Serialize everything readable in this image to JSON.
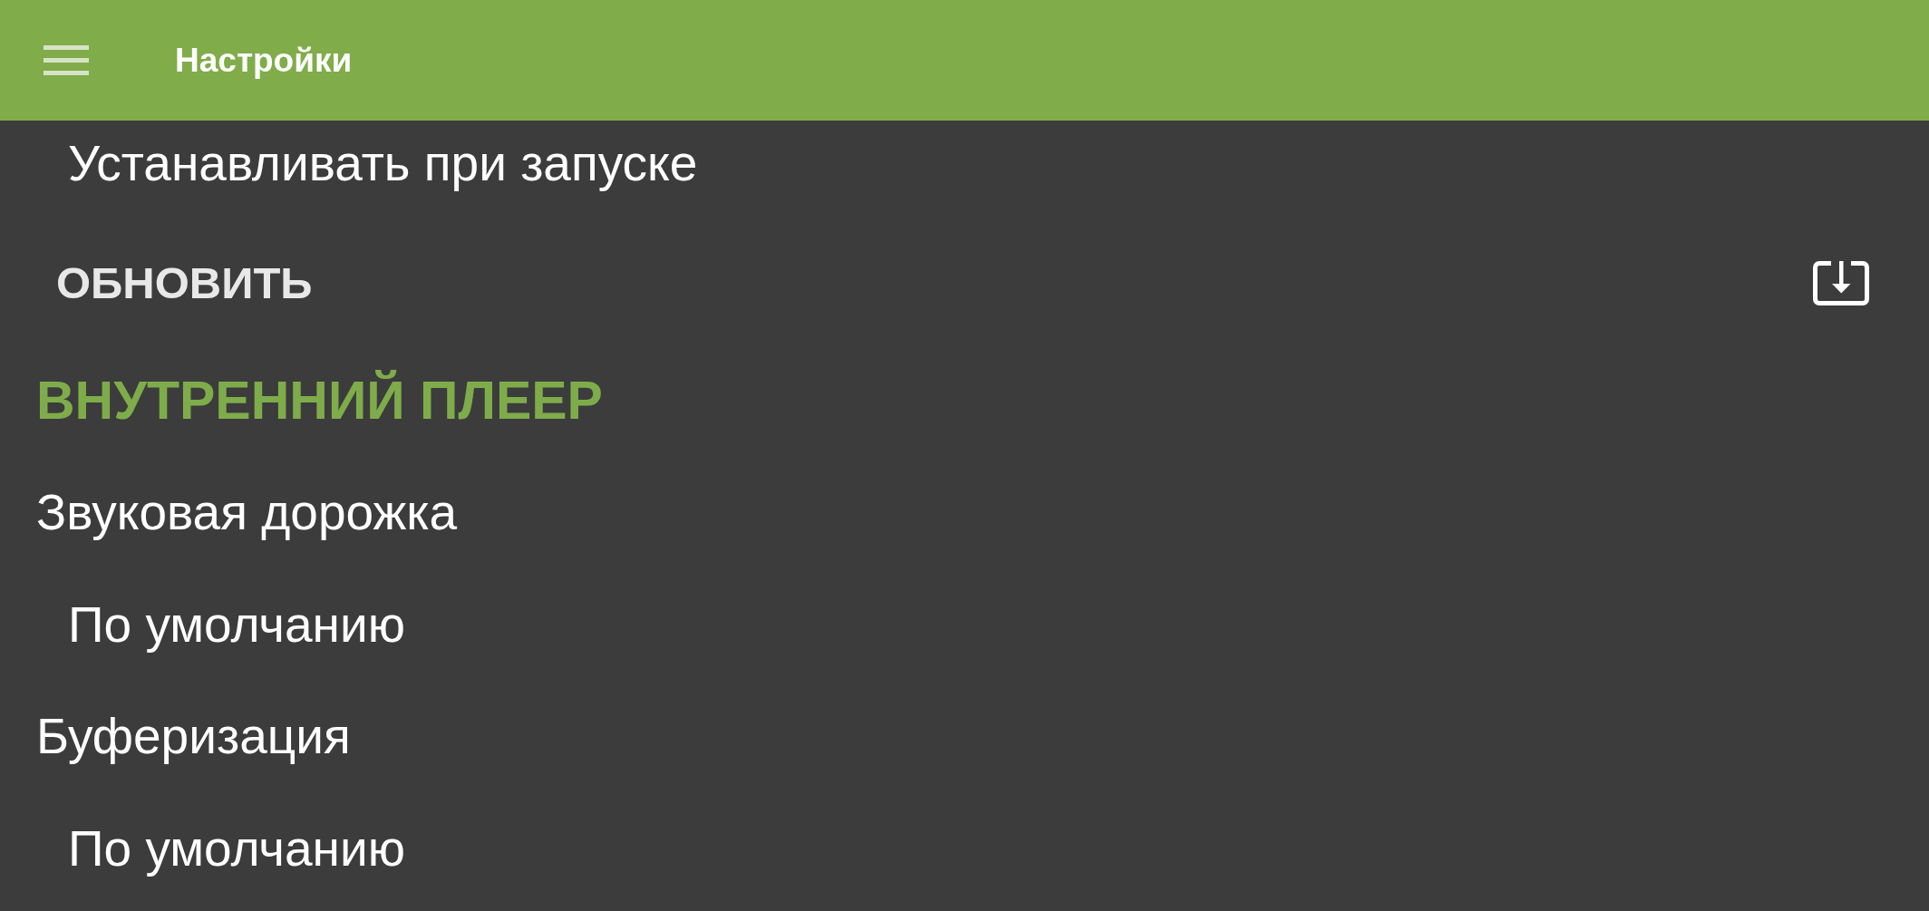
{
  "app_bar": {
    "title": "Настройки"
  },
  "rows": [
    {
      "kind": "summary",
      "text": "Устанавливать при запуске"
    },
    {
      "kind": "action",
      "text": "ОБНОВИТЬ"
    },
    {
      "kind": "section",
      "text": "ВНУТРЕННИЙ ПЛЕЕР"
    },
    {
      "kind": "preference",
      "text": "Звуковая дорожка"
    },
    {
      "kind": "summary",
      "text": "По умолчанию"
    },
    {
      "kind": "preference",
      "text": "Буферизация"
    },
    {
      "kind": "summary",
      "text": "По умолчанию"
    }
  ]
}
